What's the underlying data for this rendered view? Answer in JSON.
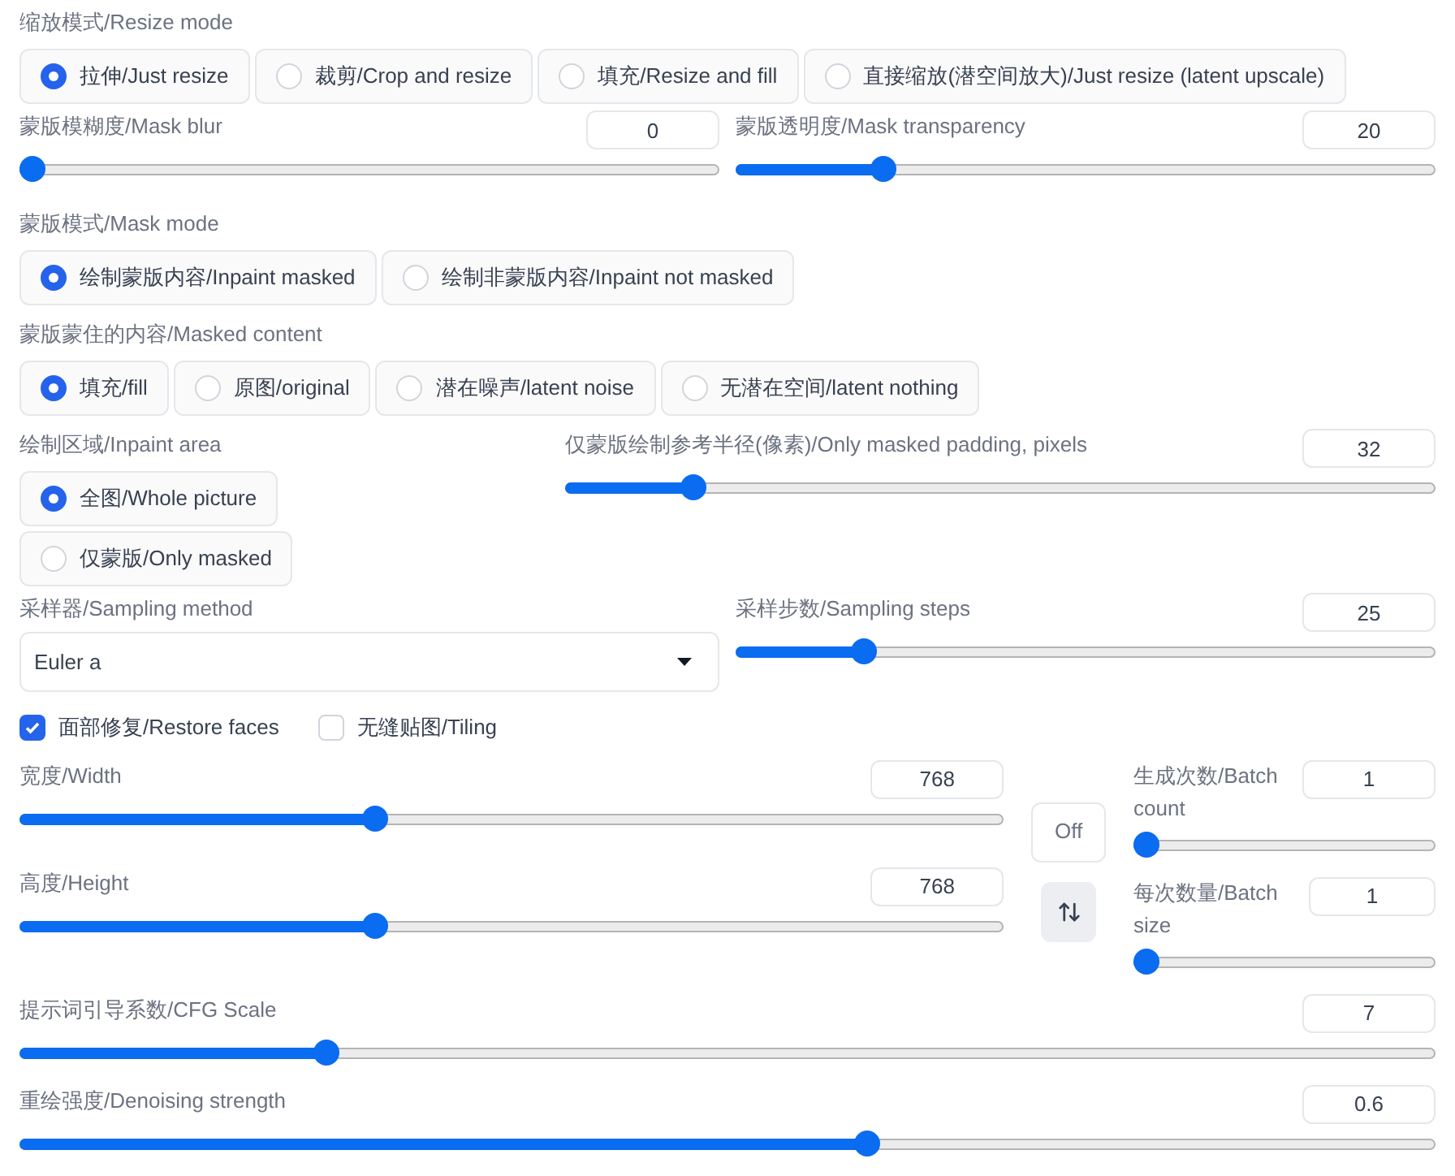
{
  "resize_mode": {
    "label": "缩放模式/Resize mode",
    "options": [
      {
        "label": "拉伸/Just resize",
        "selected": true
      },
      {
        "label": "裁剪/Crop and resize",
        "selected": false
      },
      {
        "label": "填充/Resize and fill",
        "selected": false
      },
      {
        "label": "直接缩放(潜空间放大)/Just resize (latent upscale)",
        "selected": false
      }
    ]
  },
  "mask_blur": {
    "label": "蒙版模糊度/Mask blur",
    "value": "0",
    "level": 0
  },
  "mask_transparency": {
    "label": "蒙版透明度/Mask transparency",
    "value": "20",
    "level": 0.2
  },
  "mask_mode": {
    "label": "蒙版模式/Mask mode",
    "options": [
      {
        "label": "绘制蒙版内容/Inpaint masked",
        "selected": true
      },
      {
        "label": "绘制非蒙版内容/Inpaint not masked",
        "selected": false
      }
    ]
  },
  "masked_content": {
    "label": "蒙版蒙住的内容/Masked content",
    "options": [
      {
        "label": "填充/fill",
        "selected": true
      },
      {
        "label": "原图/original",
        "selected": false
      },
      {
        "label": "潜在噪声/latent noise",
        "selected": false
      },
      {
        "label": "无潜在空间/latent nothing",
        "selected": false
      }
    ]
  },
  "inpaint_area": {
    "label": "绘制区域/Inpaint area",
    "options": [
      {
        "label": "全图/Whole picture",
        "selected": true
      },
      {
        "label": "仅蒙版/Only masked",
        "selected": false
      }
    ]
  },
  "masked_padding": {
    "label": "仅蒙版绘制参考半径(像素)/Only masked padding, pixels",
    "value": "32",
    "level": 0.136
  },
  "sampling_method": {
    "label": "采样器/Sampling method",
    "value": "Euler a"
  },
  "sampling_steps": {
    "label": "采样步数/Sampling steps",
    "value": "25",
    "level": 0.17
  },
  "checkboxes": [
    {
      "label": "面部修复/Restore faces",
      "checked": true
    },
    {
      "label": "无缝贴图/Tiling",
      "checked": false
    }
  ],
  "width": {
    "label": "宽度/Width",
    "value": "768",
    "level": 0.358
  },
  "height": {
    "label": "高度/Height",
    "value": "768",
    "level": 0.358
  },
  "off_button": "Off",
  "batch_count": {
    "label": "生成次数/Batch count",
    "value": "1",
    "level": 0
  },
  "batch_size": {
    "label": "每次数量/Batch size",
    "value": "1",
    "level": 0
  },
  "cfg_scale": {
    "label": "提示词引导系数/CFG Scale",
    "value": "7",
    "level": 0.212
  },
  "denoising_strength": {
    "label": "重绘强度/Denoising strength",
    "value": "0.6",
    "level": 0.6
  }
}
